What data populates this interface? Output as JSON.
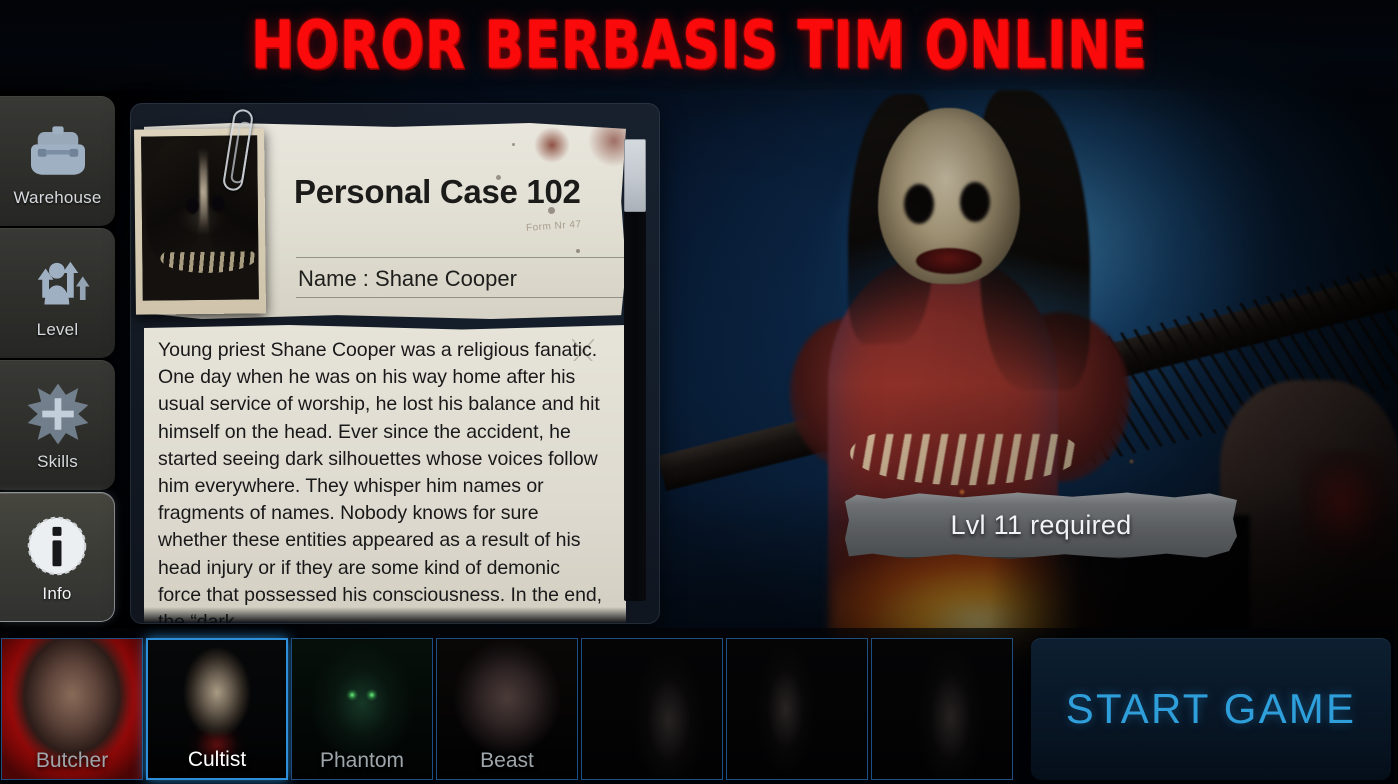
{
  "header": {
    "title": "HOROR BERBASIS TIM ONLINE",
    "title_color": "#fa0a0a"
  },
  "sidebar": {
    "items": [
      {
        "id": "warehouse",
        "label": "Warehouse",
        "icon": "backpack-icon",
        "active": false
      },
      {
        "id": "level",
        "label": "Level",
        "icon": "level-up-icon",
        "active": false
      },
      {
        "id": "skills",
        "label": "Skills",
        "icon": "skill-star-icon",
        "active": false
      },
      {
        "id": "info",
        "label": "Info",
        "icon": "info-circle-icon",
        "active": true
      }
    ]
  },
  "dossier": {
    "card_title": "Personal Case 102",
    "name_label": "Name : Shane Cooper",
    "faded_stamp": "Form Nr 47",
    "photo_alt": "cultist-portrait",
    "body_text": "Young priest Shane Cooper was a religious fanatic. One day when he was on his way home after his usual service of worship, he lost his balance and hit himself on the head. Ever since the accident, he started seeing dark silhouettes whose voices follow him everywhere. They whisper him names or fragments of names. Nobody knows for sure whether these entities appeared as a result of his head injury or if they are some kind of demonic force that possessed his consciousness. In the end, the “dark",
    "scroll_thumb_position_percent": 4
  },
  "stage": {
    "level_requirement_text": "Lvl 11 required",
    "character_art_alt": "butcher-character-artwork"
  },
  "character_slots": [
    {
      "id": "butcher",
      "label": "Butcher",
      "art": "art-butcher",
      "selected": false,
      "locked": false
    },
    {
      "id": "cultist",
      "label": "Cultist",
      "art": "art-cultist",
      "selected": true,
      "locked": false
    },
    {
      "id": "phantom",
      "label": "Phantom",
      "art": "art-phantom",
      "selected": false,
      "locked": false
    },
    {
      "id": "beast",
      "label": "Beast",
      "art": "art-beast",
      "selected": false,
      "locked": false
    },
    {
      "id": "locked-1",
      "label": "",
      "art": "art-locked-a",
      "selected": false,
      "locked": true
    },
    {
      "id": "locked-2",
      "label": "",
      "art": "art-locked-b",
      "selected": false,
      "locked": true
    },
    {
      "id": "locked-3",
      "label": "",
      "art": "art-locked-c",
      "selected": false,
      "locked": true
    }
  ],
  "actions": {
    "start_game_label": "START GAME",
    "start_game_color": "#2e9fda"
  },
  "theme": {
    "accent_blue": "#2e8fd8",
    "slot_border": "#1d4f82",
    "danger_red": "#fa0a0a",
    "paper": "#e6e3d9",
    "sidebar_panel": "#2e2e2b"
  }
}
